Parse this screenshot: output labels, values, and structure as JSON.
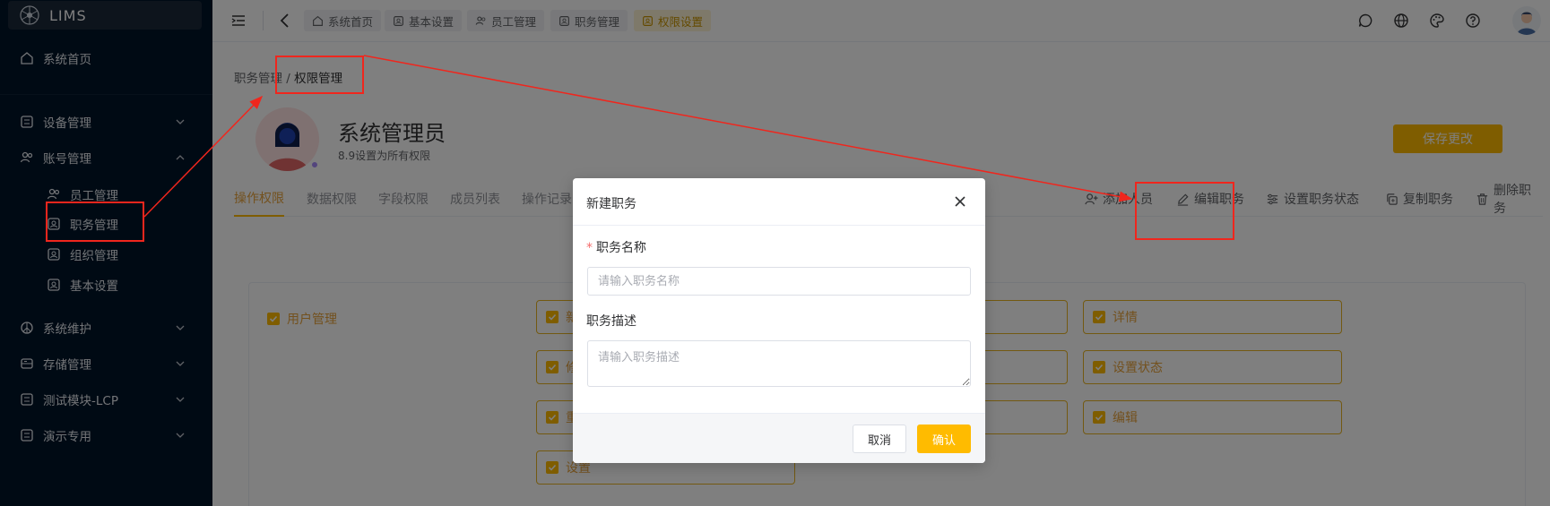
{
  "app": {
    "name": "LIMS"
  },
  "sidebar": {
    "home": "系统首页",
    "items": [
      {
        "label": "设备管理"
      },
      {
        "label": "账号管理"
      },
      {
        "label": "员工管理"
      },
      {
        "label": "职务管理"
      },
      {
        "label": "组织管理"
      },
      {
        "label": "基本设置"
      },
      {
        "label": "系统维护"
      },
      {
        "label": "存储管理"
      },
      {
        "label": "测试模块-LCP"
      },
      {
        "label": "演示专用"
      }
    ]
  },
  "topbar": {
    "tabs": [
      {
        "label": "系统首页",
        "icon": "home-icon"
      },
      {
        "label": "基本设置",
        "icon": "id-card-icon"
      },
      {
        "label": "员工管理",
        "icon": "users-icon"
      },
      {
        "label": "职务管理",
        "icon": "id-card-icon"
      },
      {
        "label": "权限设置",
        "icon": "id-card-icon",
        "active": true
      }
    ],
    "right_icons": [
      "chat-icon",
      "globe-icon",
      "palette-icon",
      "help-icon",
      "avatar"
    ]
  },
  "breadcrumb": {
    "parent": "职务管理",
    "separator": "/",
    "current": "权限管理"
  },
  "role": {
    "title": "系统管理员",
    "description": "8.9设置为所有权限"
  },
  "save_button": "保存更改",
  "page_tabs": [
    "操作权限",
    "数据权限",
    "字段权限",
    "成员列表",
    "操作记录"
  ],
  "actions": [
    "添加人员",
    "编辑职务",
    "设置职务状态",
    "复制职务",
    "删除职务"
  ],
  "permissions": {
    "group": "用户管理",
    "col2": [
      "新",
      "修",
      "重",
      "设置"
    ],
    "col4": [
      "详情",
      "设置状态",
      "编辑"
    ]
  },
  "dialog": {
    "title": "新建职务",
    "name_label": "职务名称",
    "name_placeholder": "请输入职务名称",
    "desc_label": "职务描述",
    "desc_placeholder": "请输入职务描述",
    "cancel": "取消",
    "confirm": "确认"
  },
  "colors": {
    "accent": "#ffbb00",
    "sidebar_bg": "#001529",
    "annotation": "#f0261d"
  }
}
